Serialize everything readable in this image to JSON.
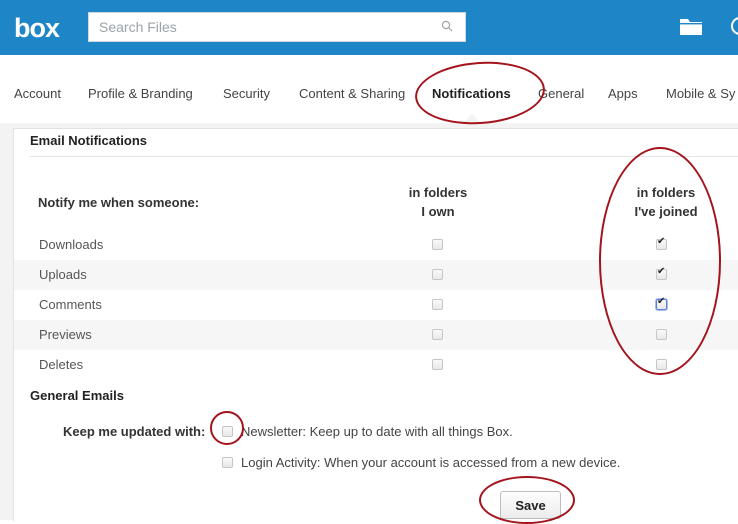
{
  "header": {
    "logo": "box",
    "search_placeholder": "Search Files",
    "folder_icon": "folder-icon",
    "brand_color": "#1e86c6"
  },
  "nav": {
    "tabs": [
      {
        "label": "Account"
      },
      {
        "label": "Profile & Branding"
      },
      {
        "label": "Security"
      },
      {
        "label": "Content & Sharing"
      },
      {
        "label": "Notifications",
        "active": true
      },
      {
        "label": "General"
      },
      {
        "label": "Apps"
      },
      {
        "label": "Mobile & Sy"
      }
    ]
  },
  "email_notifications": {
    "title": "Email Notifications",
    "notify_label": "Notify me when someone:",
    "col_own": [
      "in folders",
      "I own"
    ],
    "col_joined": [
      "in folders",
      "I've joined"
    ],
    "rows": [
      {
        "label": "Downloads",
        "own": false,
        "joined": true
      },
      {
        "label": "Uploads",
        "own": false,
        "joined": true
      },
      {
        "label": "Comments",
        "own": false,
        "joined": true
      },
      {
        "label": "Previews",
        "own": false,
        "joined": false
      },
      {
        "label": "Deletes",
        "own": false,
        "joined": false
      }
    ]
  },
  "general_emails": {
    "title": "General Emails",
    "keep_label": "Keep me updated with:",
    "options": [
      {
        "label": "Newsletter: Keep up to date with all things Box.",
        "checked": false
      },
      {
        "label": "Login Activity: When your account is accessed from a new device.",
        "checked": false
      }
    ]
  },
  "actions": {
    "save_label": "Save"
  },
  "annotation_color": "#a3141c"
}
